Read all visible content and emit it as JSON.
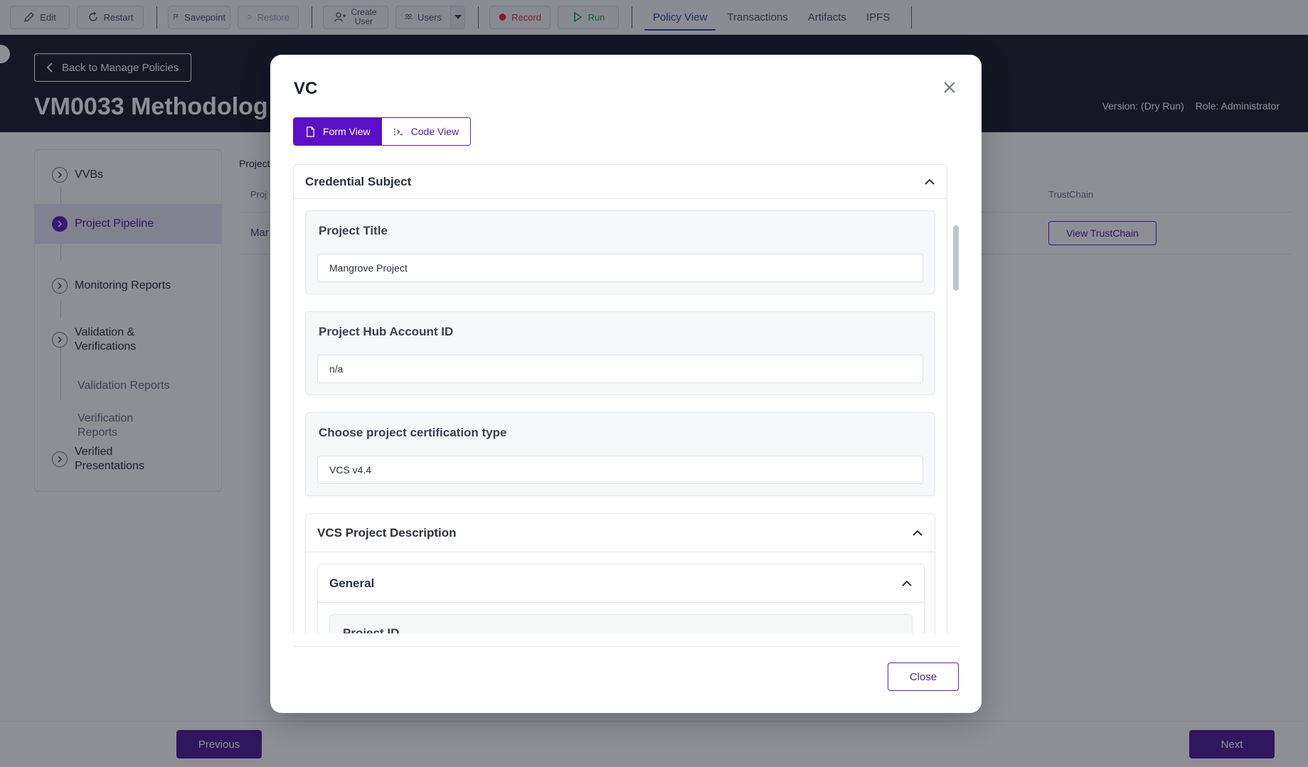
{
  "toolbar": {
    "edit": "Edit",
    "restart": "Restart",
    "savepoint": "Savepoint",
    "restore": "Restore",
    "create_user_line1": "Create",
    "create_user_line2": "User",
    "users": "Users",
    "record": "Record",
    "run": "Run",
    "tabs": [
      "Policy View",
      "Transactions",
      "Artifacts",
      "IPFS"
    ]
  },
  "header": {
    "back": "Back to Manage Policies",
    "title": "VM0033 Methodolog",
    "version": "Version: (Dry Run)",
    "role": "Role: Administrator"
  },
  "sidebar": {
    "vvbs": "VVBs",
    "project_pipeline": "Project Pipeline",
    "monitoring_reports": "Monitoring Reports",
    "validation_line1": "Validation &",
    "validation_line2": "Verifications",
    "validation_reports": "Validation Reports",
    "verification_line1": "Verification",
    "verification_line2": "Reports",
    "verified_line1": "Verified",
    "verified_line2": "Presentations"
  },
  "table": {
    "header": "Project",
    "col_project": "Proj",
    "col_trustchain": "TrustChain",
    "row_cell": "Mar",
    "view_trustchain": "View TrustChain"
  },
  "footer": {
    "previous": "Previous",
    "next": "Next"
  },
  "modal": {
    "title": "VC",
    "form_view": "Form View",
    "code_view": "Code View",
    "section_title": "Credential Subject",
    "fields": [
      {
        "label": "Project Title",
        "value": "Mangrove Project"
      },
      {
        "label": "Project Hub Account ID",
        "value": "n/a"
      },
      {
        "label": "Choose project certification type",
        "value": "VCS v4.4"
      }
    ],
    "subsection_title": "VCS Project Description",
    "general_title": "General",
    "project_id_label": "Project ID",
    "close": "Close"
  },
  "colors": {
    "primary": "#4c1d95",
    "accent": "#5b0fc7",
    "header_bg": "#1c1f2b",
    "record": "#e02d2d",
    "run": "#1f9f4e"
  }
}
